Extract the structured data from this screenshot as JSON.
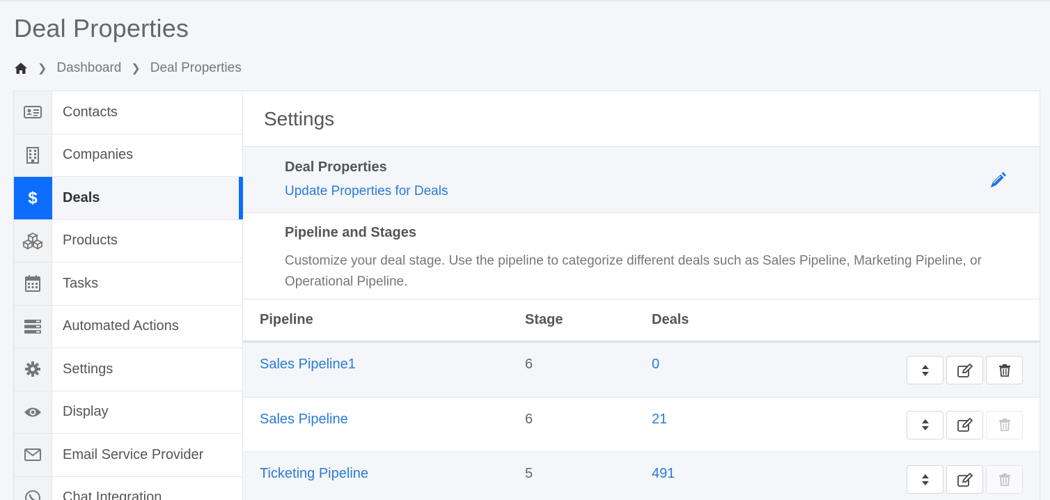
{
  "page": {
    "title": "Deal Properties",
    "breadcrumb": [
      "Dashboard",
      "Deal Properties"
    ]
  },
  "sidebar": {
    "items": [
      {
        "label": "Contacts",
        "icon": "contact-card-icon"
      },
      {
        "label": "Companies",
        "icon": "building-icon"
      },
      {
        "label": "Deals",
        "icon": "dollar-icon",
        "active": true
      },
      {
        "label": "Products",
        "icon": "cubes-icon"
      },
      {
        "label": "Tasks",
        "icon": "calendar-icon"
      },
      {
        "label": "Automated Actions",
        "icon": "server-icon"
      },
      {
        "label": "Settings",
        "icon": "gear-icon"
      },
      {
        "label": "Display",
        "icon": "eye-icon"
      },
      {
        "label": "Email Service Provider",
        "icon": "envelope-icon"
      },
      {
        "label": "Chat Integration",
        "icon": "whatsapp-icon"
      }
    ]
  },
  "main": {
    "header": "Settings",
    "deal_properties": {
      "title": "Deal Properties",
      "link": "Update Properties for Deals"
    },
    "pipeline_section": {
      "title": "Pipeline and Stages",
      "description": "Customize your deal stage. Use the pipeline to categorize different deals such as Sales Pipeline, Marketing Pipeline, or Operational Pipeline."
    },
    "table": {
      "headers": [
        "Pipeline",
        "Stage",
        "Deals"
      ],
      "rows": [
        {
          "pipeline": "Sales Pipeline1",
          "stage": "6",
          "deals": "0",
          "delete_enabled": true
        },
        {
          "pipeline": "Sales Pipeline",
          "stage": "6",
          "deals": "21",
          "delete_enabled": false
        },
        {
          "pipeline": "Ticketing Pipeline",
          "stage": "5",
          "deals": "491",
          "delete_enabled": false
        }
      ]
    }
  },
  "colors": {
    "accent": "#0d6efd",
    "link": "#2a7bd6",
    "page_bg": "#f4f6f9"
  }
}
